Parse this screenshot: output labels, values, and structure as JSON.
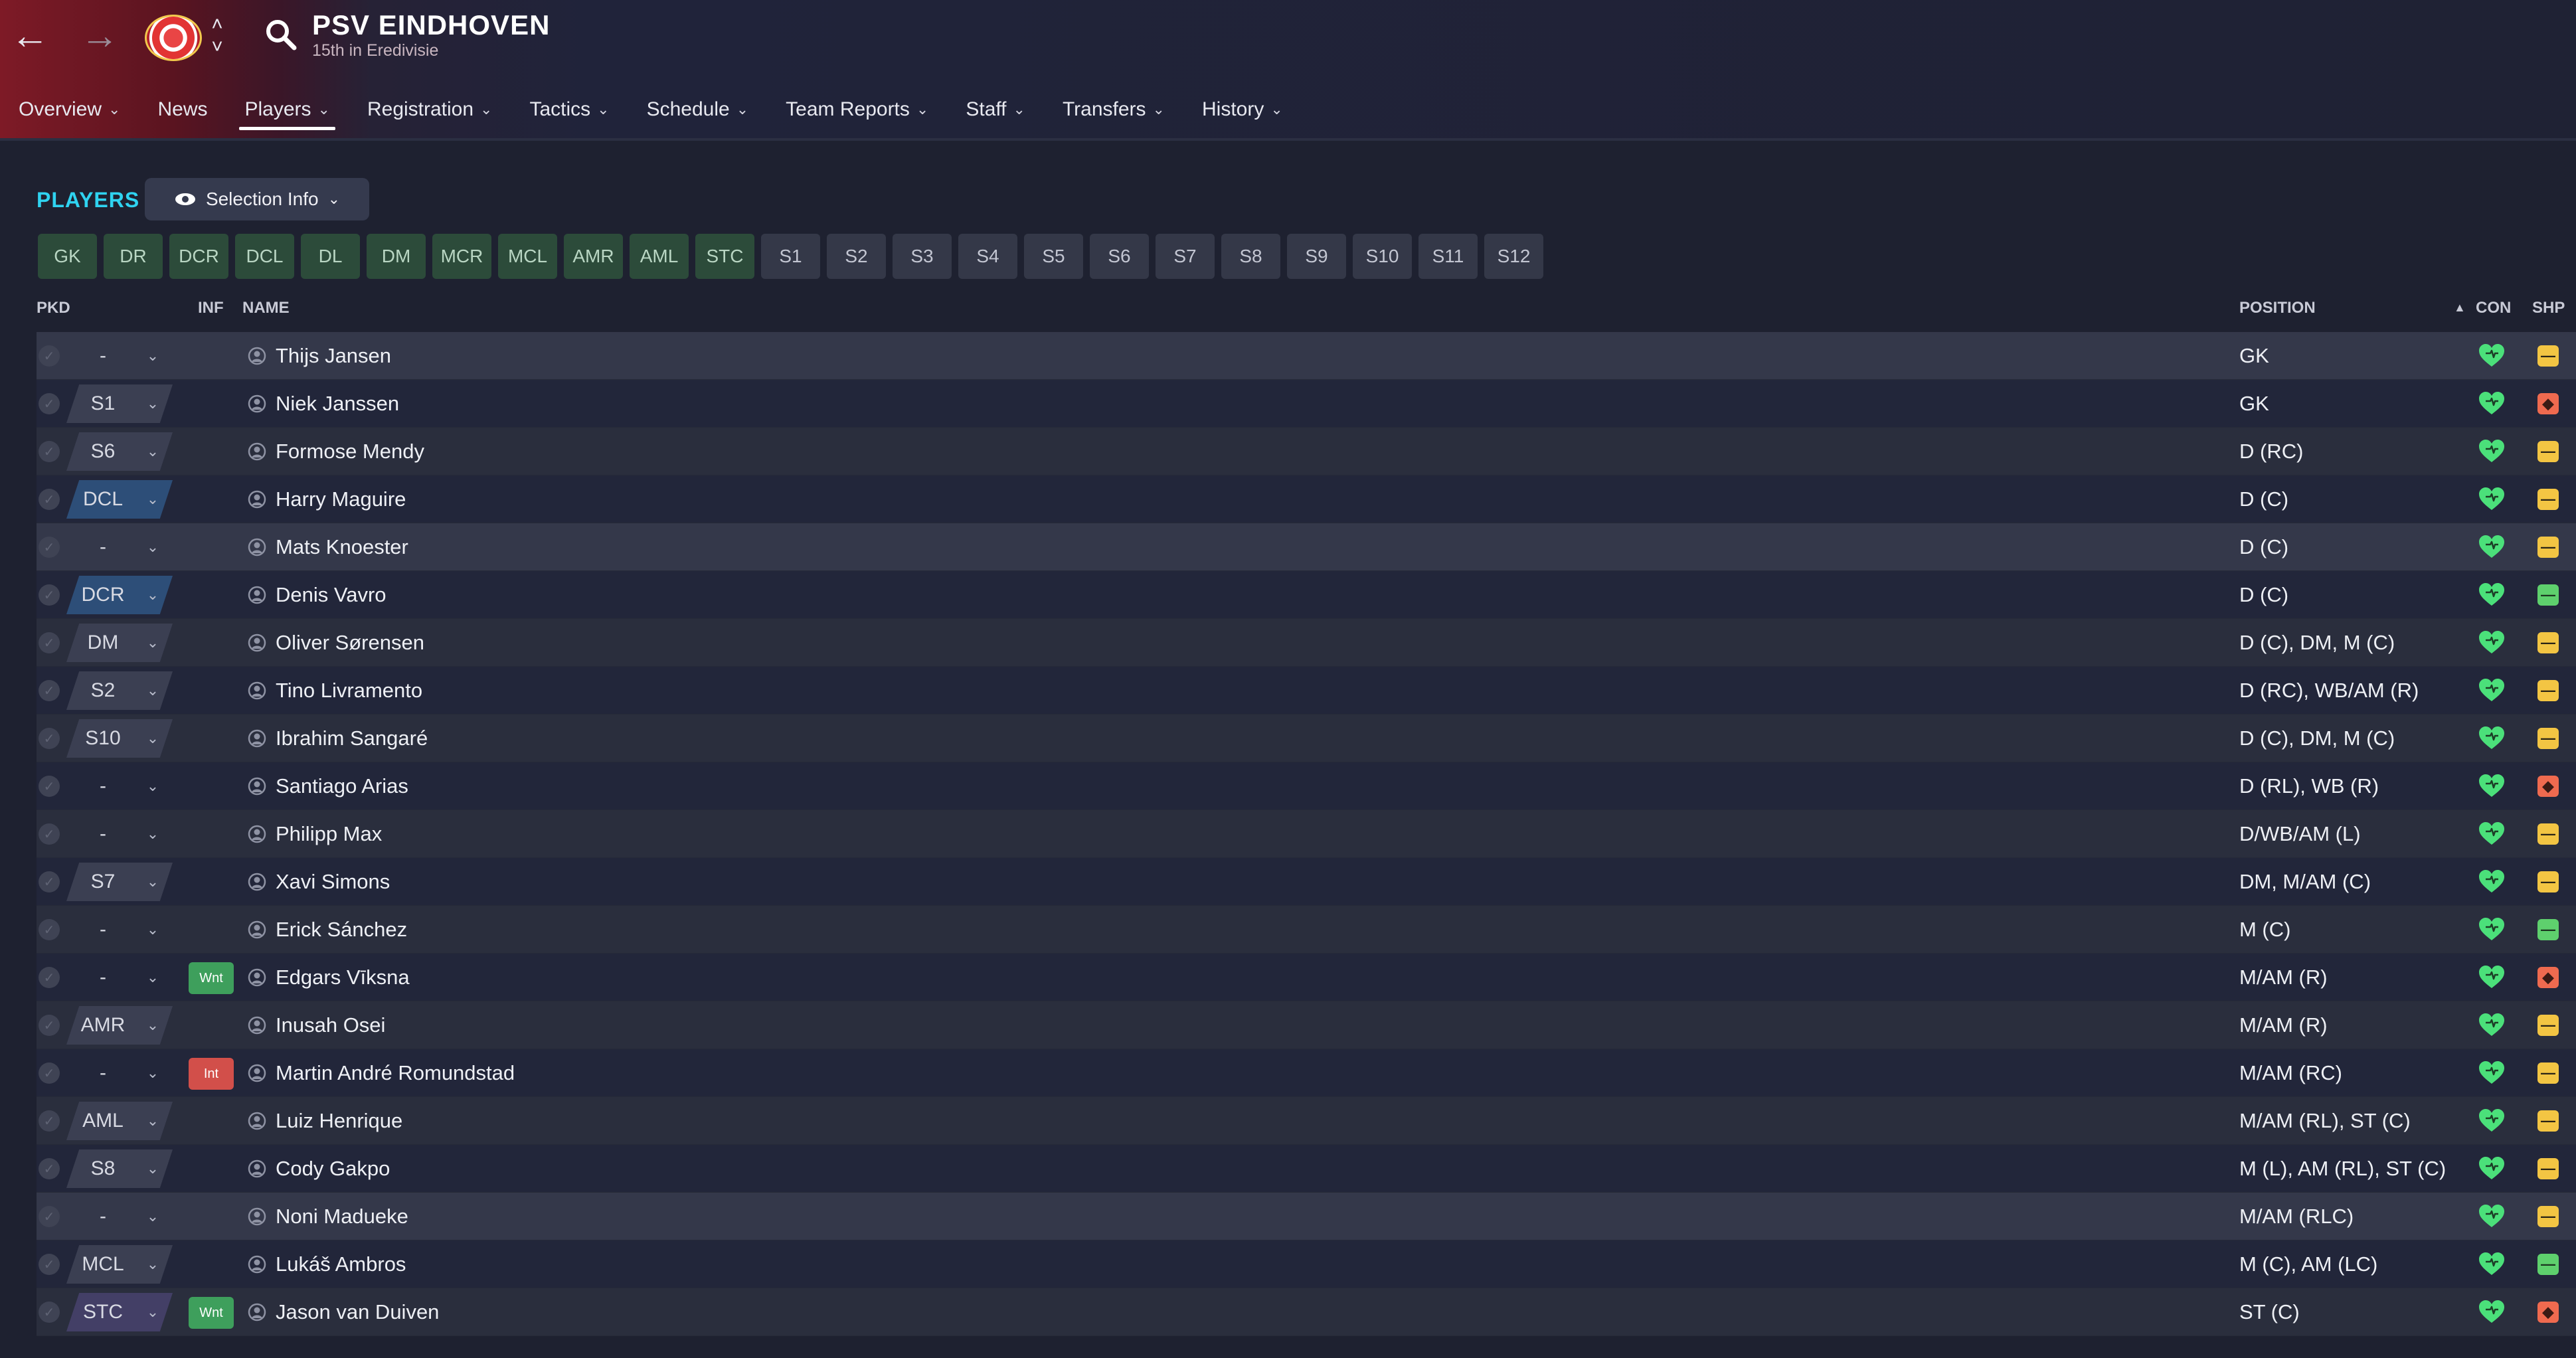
{
  "header": {
    "club_name": "PSV EINDHOVEN",
    "club_sub": "15th in Eredivisie",
    "back_icon": "←",
    "fwd_icon": "→",
    "tabs": [
      {
        "label": "Overview",
        "chev": "⌄"
      },
      {
        "label": "News",
        "chev": ""
      },
      {
        "label": "Players",
        "chev": "⌄"
      },
      {
        "label": "Registration",
        "chev": "⌄"
      },
      {
        "label": "Tactics",
        "chev": "⌄"
      },
      {
        "label": "Schedule",
        "chev": "⌄"
      },
      {
        "label": "Team Reports",
        "chev": "⌄"
      },
      {
        "label": "Staff",
        "chev": "⌄"
      },
      {
        "label": "Transfers",
        "chev": "⌄"
      },
      {
        "label": "History",
        "chev": "⌄"
      }
    ],
    "active_tab": "Players"
  },
  "players_section": {
    "title": "PLAYERS",
    "selection_info": "Selection Info",
    "tactic_positions": [
      "GK",
      "DR",
      "DCR",
      "DCL",
      "DL",
      "DM",
      "MCR",
      "MCL",
      "AMR",
      "AML",
      "STC"
    ],
    "sub_slots": [
      "S1",
      "S2",
      "S3",
      "S4",
      "S5",
      "S6",
      "S7",
      "S8",
      "S9",
      "S10",
      "S11",
      "S12"
    ]
  },
  "table": {
    "columns": {
      "pkd": "PKD",
      "inf": "INF",
      "name": "NAME",
      "position": "POSITION",
      "con": "CON",
      "shp": "SHP"
    },
    "rows": [
      {
        "pkd": "-",
        "inf": "",
        "name": "Thijs Jansen",
        "position": "GK",
        "shp": "yellow"
      },
      {
        "pkd": "S1",
        "inf": "",
        "name": "Niek Janssen",
        "position": "GK",
        "shp": "red"
      },
      {
        "pkd": "S6",
        "inf": "",
        "name": "Formose Mendy",
        "position": "D (RC)",
        "shp": "yellow"
      },
      {
        "pkd": "DCL",
        "inf": "",
        "name": "Harry Maguire",
        "position": "D (C)",
        "shp": "yellow"
      },
      {
        "pkd": "-",
        "inf": "",
        "name": "Mats Knoester",
        "position": "D (C)",
        "shp": "yellow"
      },
      {
        "pkd": "DCR",
        "inf": "",
        "name": "Denis Vavro",
        "position": "D (C)",
        "shp": "green"
      },
      {
        "pkd": "DM",
        "inf": "",
        "name": "Oliver Sørensen",
        "position": "D (C), DM, M (C)",
        "shp": "yellow"
      },
      {
        "pkd": "S2",
        "inf": "",
        "name": "Tino Livramento",
        "position": "D (RC), WB/AM (R)",
        "shp": "yellow"
      },
      {
        "pkd": "S10",
        "inf": "",
        "name": "Ibrahim Sangaré",
        "position": "D (C), DM, M (C)",
        "shp": "yellow"
      },
      {
        "pkd": "-",
        "inf": "",
        "name": "Santiago Arias",
        "position": "D (RL), WB (R)",
        "shp": "red"
      },
      {
        "pkd": "-",
        "inf": "",
        "name": "Philipp Max",
        "position": "D/WB/AM (L)",
        "shp": "yellow"
      },
      {
        "pkd": "S7",
        "inf": "",
        "name": "Xavi Simons",
        "position": "DM, M/AM (C)",
        "shp": "yellow"
      },
      {
        "pkd": "-",
        "inf": "",
        "name": "Erick Sánchez",
        "position": "M (C)",
        "shp": "green"
      },
      {
        "pkd": "-",
        "inf": "Wnt",
        "name": "Edgars Vīksna",
        "position": "M/AM (R)",
        "shp": "red"
      },
      {
        "pkd": "AMR",
        "inf": "",
        "name": "Inusah Osei",
        "position": "M/AM (R)",
        "shp": "yellow"
      },
      {
        "pkd": "-",
        "inf": "Int",
        "name": "Martin André Romundstad",
        "position": "M/AM (RC)",
        "shp": "yellow"
      },
      {
        "pkd": "AML",
        "inf": "",
        "name": "Luiz Henrique",
        "position": "M/AM (RL), ST (C)",
        "shp": "yellow"
      },
      {
        "pkd": "S8",
        "inf": "",
        "name": "Cody Gakpo",
        "position": "M (L), AM (RL), ST (C)",
        "shp": "yellow"
      },
      {
        "pkd": "-",
        "inf": "",
        "name": "Noni Madueke",
        "position": "M/AM (RLC)",
        "shp": "yellow"
      },
      {
        "pkd": "MCL",
        "inf": "",
        "name": "Lukáš Ambros",
        "position": "M (C), AM (LC)",
        "shp": "green"
      },
      {
        "pkd": "STC",
        "inf": "Wnt",
        "name": "Jason van Duiven",
        "position": "ST (C)",
        "shp": "red"
      }
    ]
  },
  "colors": {
    "accent": "#2fd3f0",
    "con_heart": "#4be07a",
    "shp_yellow": "#f3c543",
    "shp_red": "#ef6a4f",
    "shp_green": "#5ed06d"
  }
}
